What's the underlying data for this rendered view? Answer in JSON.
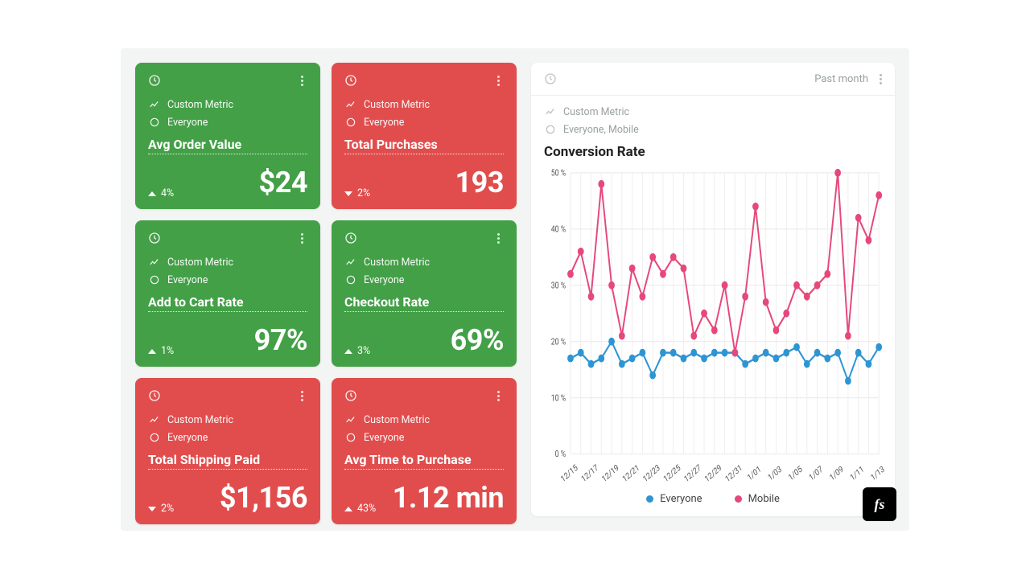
{
  "cards": [
    {
      "color": "green",
      "metric": "Custom Metric",
      "segment": "Everyone",
      "title": "Avg Order Value",
      "deltaDir": "up",
      "delta": "4%",
      "value": "$24"
    },
    {
      "color": "red",
      "metric": "Custom Metric",
      "segment": "Everyone",
      "title": "Total Purchases",
      "deltaDir": "down",
      "delta": "2%",
      "value": "193"
    },
    {
      "color": "green",
      "metric": "Custom Metric",
      "segment": "Everyone",
      "title": "Add to Cart Rate",
      "deltaDir": "up",
      "delta": "1%",
      "value": "97%"
    },
    {
      "color": "green",
      "metric": "Custom Metric",
      "segment": "Everyone",
      "title": "Checkout Rate",
      "deltaDir": "up",
      "delta": "3%",
      "value": "69%"
    },
    {
      "color": "red",
      "metric": "Custom Metric",
      "segment": "Everyone",
      "title": "Total Shipping Paid",
      "deltaDir": "down",
      "delta": "2%",
      "value": "$1,156"
    },
    {
      "color": "red",
      "metric": "Custom Metric",
      "segment": "Everyone",
      "title": "Avg Time to Purchase",
      "deltaDir": "up",
      "delta": "43%",
      "value": "1.12 min"
    }
  ],
  "panel": {
    "timeRange": "Past month",
    "metric": "Custom Metric",
    "segment": "Everyone, Mobile",
    "title": "Conversion Rate",
    "legend": [
      "Everyone",
      "Mobile"
    ]
  },
  "chart_data": {
    "type": "line",
    "ylabel": "%",
    "ylim": [
      0,
      50
    ],
    "yticks": [
      0,
      10,
      20,
      30,
      40,
      50
    ],
    "categories": [
      "12/15",
      "12/17",
      "12/19",
      "12/21",
      "12/23",
      "12/25",
      "12/27",
      "12/29",
      "12/31",
      "1/01",
      "1/03",
      "1/05",
      "1/07",
      "1/09",
      "1/11",
      "1/13"
    ],
    "series": [
      {
        "name": "Everyone",
        "color": "#2e95d3",
        "values": [
          17,
          18,
          16,
          17,
          20,
          16,
          17,
          18,
          14,
          18,
          18,
          17,
          18,
          17,
          18,
          18,
          18,
          16,
          17,
          18,
          17,
          18,
          19,
          16,
          18,
          17,
          18,
          13,
          18,
          16,
          19
        ]
      },
      {
        "name": "Mobile",
        "color": "#e6487a",
        "values": [
          32,
          36,
          28,
          48,
          30,
          21,
          33,
          28,
          35,
          32,
          35,
          33,
          21,
          25,
          22,
          30,
          18,
          28,
          44,
          27,
          22,
          25,
          30,
          28,
          30,
          32,
          50,
          21,
          42,
          38,
          46
        ]
      }
    ]
  },
  "brand": "fs"
}
